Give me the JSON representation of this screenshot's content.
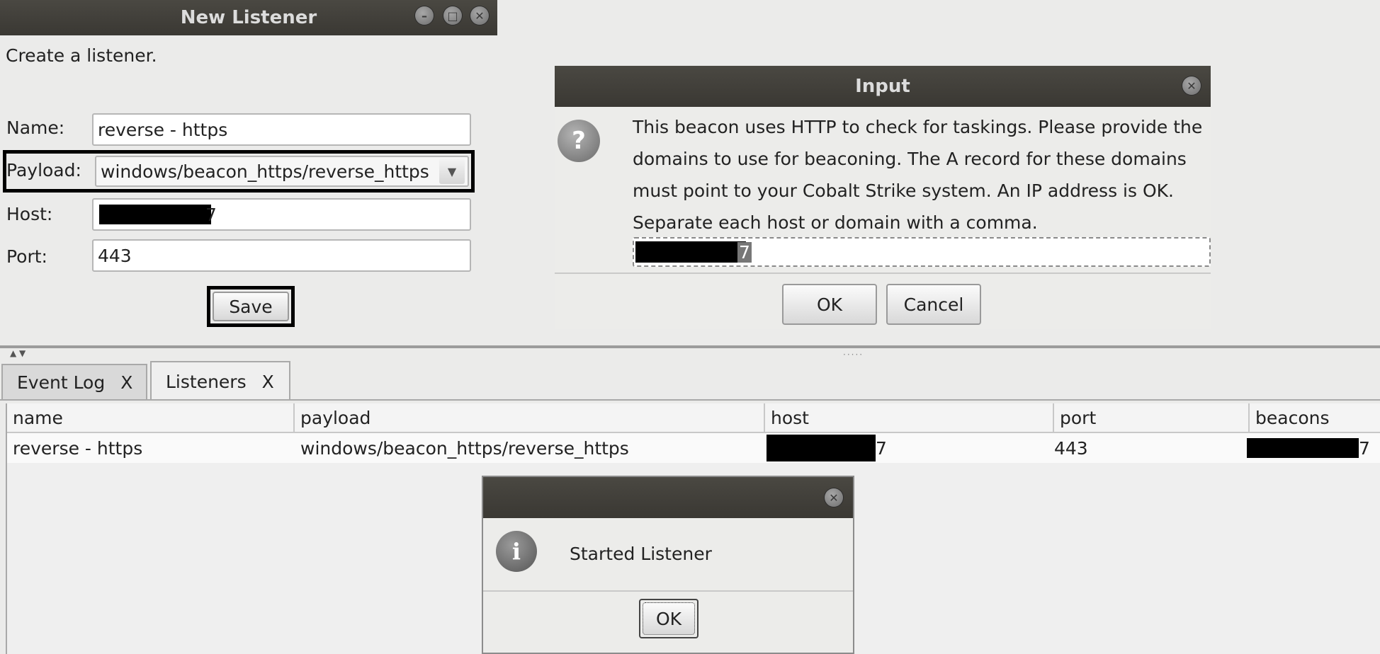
{
  "new_listener": {
    "title": "New Listener",
    "intro": "Create a listener.",
    "name_label": "Name:",
    "name_value": "reverse - https",
    "payload_label": "Payload:",
    "payload_value": "windows/beacon_https/reverse_https",
    "host_label": "Host:",
    "host_visible_suffix": "7",
    "port_label": "Port:",
    "port_value": "443",
    "save_label": "Save"
  },
  "input_dialog": {
    "title": "Input",
    "message_lines": [
      "This beacon uses HTTP to check for taskings. Please provide the",
      "domains to use for beaconing. The A record for these domains",
      "must point to your Cobalt Strike system. An IP address is OK.",
      "Separate each host or domain with a comma."
    ],
    "value_visible_suffix": "7",
    "ok_label": "OK",
    "cancel_label": "Cancel"
  },
  "tabs": [
    {
      "label": "Event Log",
      "close": "X"
    },
    {
      "label": "Listeners",
      "close": "X"
    }
  ],
  "listeners_table": {
    "columns": [
      "name",
      "payload",
      "host",
      "port",
      "beacons"
    ],
    "rows": [
      {
        "name": "reverse - https",
        "payload": "windows/beacon_https/reverse_https",
        "host_visible_suffix": "7",
        "port": "443",
        "beacons_visible_suffix": "7"
      }
    ]
  },
  "info_dialog": {
    "message": "Started Listener",
    "ok_label": "OK"
  },
  "icons": {
    "question": "question-icon",
    "info": "info-icon",
    "close": "close-icon",
    "minimize": "minimize-icon",
    "maximize": "maximize-icon",
    "dropdown": "chevron-down-icon"
  }
}
